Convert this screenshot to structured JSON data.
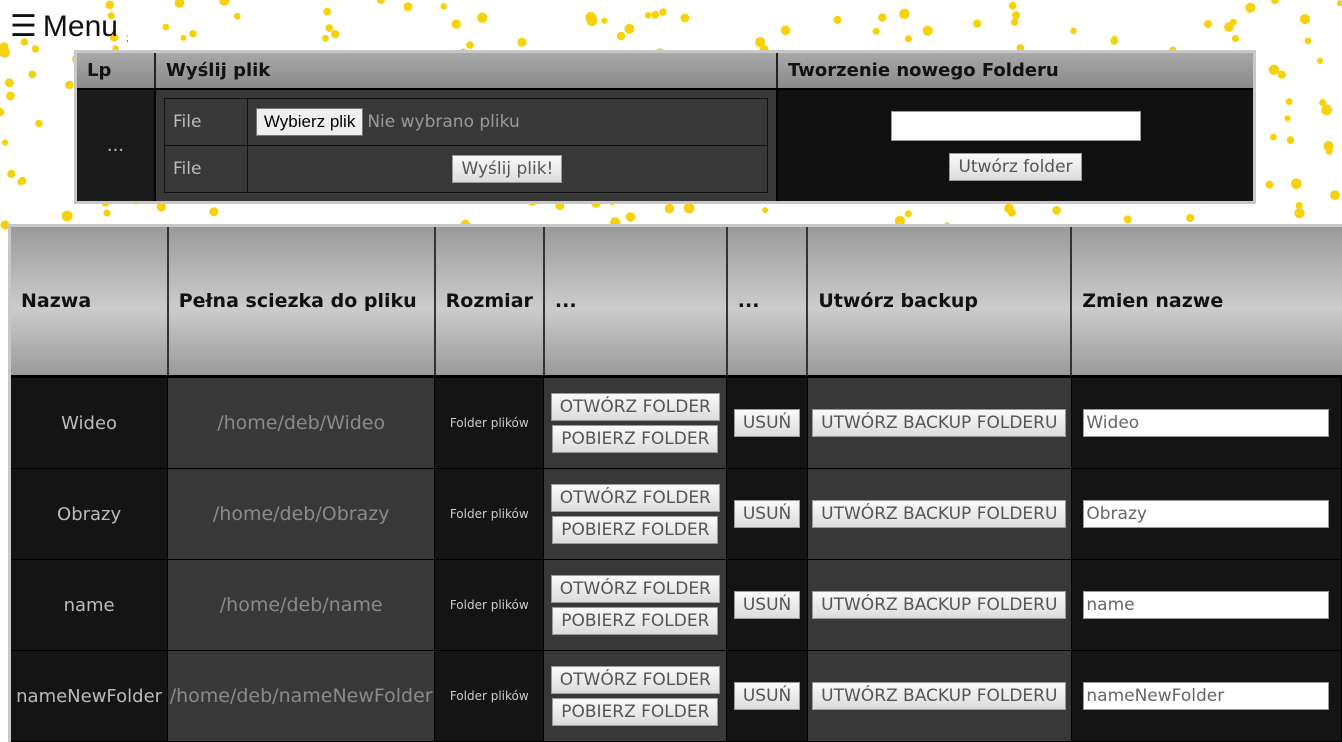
{
  "menu": {
    "icon": "hamburger-icon",
    "label": "Menu"
  },
  "upload": {
    "headers": {
      "lp": "Lp",
      "send": "Wyślij plik",
      "create": "Tworzenie nowego Folderu"
    },
    "lp_value": "...",
    "rows": [
      {
        "label": "File",
        "choose_button": "Wybierz plik",
        "status": "Nie wybrano pliku"
      },
      {
        "label": "File",
        "submit_button": "Wyślij plik!"
      }
    ],
    "folder_input_value": "",
    "create_button": "Utwórz folder"
  },
  "files": {
    "headers": [
      "Nazwa",
      "Pełna sciezka do pliku",
      "Rozmiar",
      "...",
      "...",
      "Utwórz backup",
      "Zmien nazwe"
    ],
    "rows": [
      {
        "name": "Wideo",
        "path": "/home/deb/Wideo",
        "size": "Folder plików",
        "open": "OTWÓRZ FOLDER",
        "download": "POBIERZ FOLDER",
        "delete": "USUŃ",
        "backup": "UTWÓRZ BACKUP FOLDERU",
        "rename": "Wideo"
      },
      {
        "name": "Obrazy",
        "path": "/home/deb/Obrazy",
        "size": "Folder plików",
        "open": "OTWÓRZ FOLDER",
        "download": "POBIERZ FOLDER",
        "delete": "USUŃ",
        "backup": "UTWÓRZ BACKUP FOLDERU",
        "rename": "Obrazy"
      },
      {
        "name": "name",
        "path": "/home/deb/name",
        "size": "Folder plików",
        "open": "OTWÓRZ FOLDER",
        "download": "POBIERZ FOLDER",
        "delete": "USUŃ",
        "backup": "UTWÓRZ BACKUP FOLDERU",
        "rename": "name"
      },
      {
        "name": "nameNewFolder",
        "path": "/home/deb/nameNewFolder",
        "size": "Folder plików",
        "open": "OTWÓRZ FOLDER",
        "download": "POBIERZ FOLDER",
        "delete": "USUŃ",
        "backup": "UTWÓRZ BACKUP FOLDERU",
        "rename": "nameNewFolder"
      }
    ]
  },
  "colors": {
    "dots": "#f5d20a",
    "panel_dark": "#141414",
    "panel_mid": "#383838",
    "header_gray": "#a0a0a0"
  }
}
